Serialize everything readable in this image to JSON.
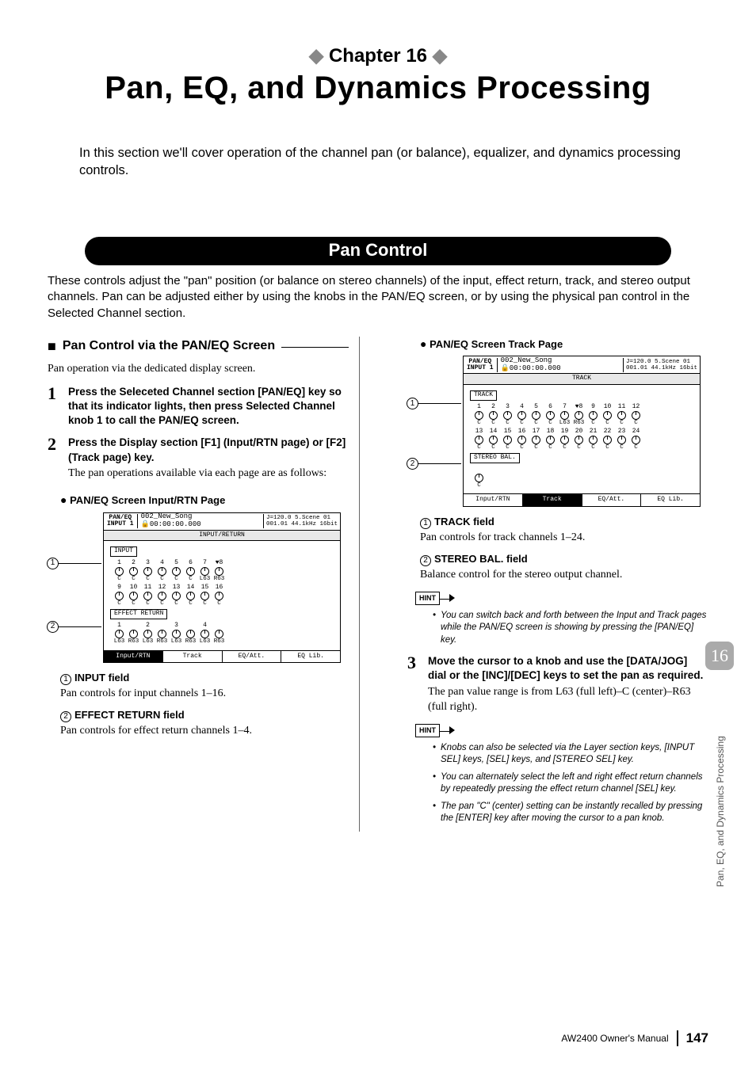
{
  "chapter_label": "Chapter 16",
  "page_title": "Pan, EQ, and Dynamics Processing",
  "intro": "In this section we'll cover operation of the channel pan (or balance), equalizer, and dynamics processing controls.",
  "section_bar": "Pan Control",
  "section_desc": "These controls adjust the \"pan\" position (or balance on stereo channels) of the input, effect return, track, and stereo output channels. Pan can be adjusted either by using the knobs in the PAN/EQ screen, or by using the physical pan control in the Selected Channel section.",
  "left": {
    "subhead": "Pan Control via the PAN/EQ Screen",
    "subdesc": "Pan operation via the dedicated display screen.",
    "step1_title": "Press the Seleceted Channel section [PAN/EQ] key so that its indicator lights, then press Selected Channel knob 1 to call the PAN/EQ screen.",
    "step2_title": "Press the Display section [F1] (Input/RTN page) or [F2] (Track page) key.",
    "step2_text": "The pan operations available via each page are as follows:",
    "ss1_title": "PAN/EQ Screen Input/RTN Page",
    "ss1": {
      "hl1": "PAN/EQ",
      "hl2": "INPUT 1",
      "song": "002_New_Song",
      "time": "00:00:00.000",
      "tempo": "J=120.0",
      "scene": "5.Scene 01",
      "meta": "001.01 44.1kHz 16bit",
      "tab": "INPUT/RETURN",
      "g1": "INPUT",
      "g2": "EFFECT RETURN",
      "footer_active": "Input/RTN",
      "f2": "Track",
      "f3": "EQ/Att.",
      "f4": "EQ Lib."
    },
    "field1_label": "INPUT field",
    "field1_desc": "Pan controls for input channels 1–16.",
    "field2_label": "EFFECT RETURN field",
    "field2_desc": "Pan controls for effect return channels 1–4."
  },
  "right": {
    "ss2_title": "PAN/EQ Screen Track Page",
    "ss2": {
      "hl1": "PAN/EQ",
      "hl2": "INPUT 1",
      "song": "002_New_Song",
      "time": "00:00:00.000",
      "tempo": "J=120.0",
      "scene": "5.Scene 01",
      "meta": "001.01 44.1kHz 16bit",
      "tab": "TRACK",
      "g1": "TRACK",
      "g2": "STEREO BAL.",
      "f1": "Input/RTN",
      "footer_active": "Track",
      "f3": "EQ/Att.",
      "f4": "EQ Lib."
    },
    "field1_label": "TRACK field",
    "field1_desc": "Pan controls for track channels 1–24.",
    "field2_label": "STEREO BAL. field",
    "field2_desc": "Balance control for the stereo output channel.",
    "hint1_item1": "You can switch back and forth between the Input and Track pages while the PAN/EQ screen is showing by pressing the [PAN/EQ] key.",
    "step3_title": "Move the cursor to a knob and use the [DATA/JOG] dial or the [INC]/[DEC] keys to set the pan as required.",
    "step3_text": "The pan value range is from L63 (full left)–C (center)–R63 (full right).",
    "hint2_item1": "Knobs can also be selected via the Layer section keys, [INPUT SEL] keys, [SEL] keys, and [STEREO SEL] key.",
    "hint2_item2": "You can alternately select the left and right effect return channels by repeatedly pressing the effect return channel [SEL] key.",
    "hint2_item3": "The pan \"C\" (center) setting can be instantly recalled by pressing the [ENTER] key after moving the cursor to a pan knob."
  },
  "side_num": "16",
  "side_text": "Pan, EQ, and Dynamics Processing",
  "footer_text": "AW2400  Owner's Manual",
  "page_num": "147",
  "hint_label": "HINT"
}
